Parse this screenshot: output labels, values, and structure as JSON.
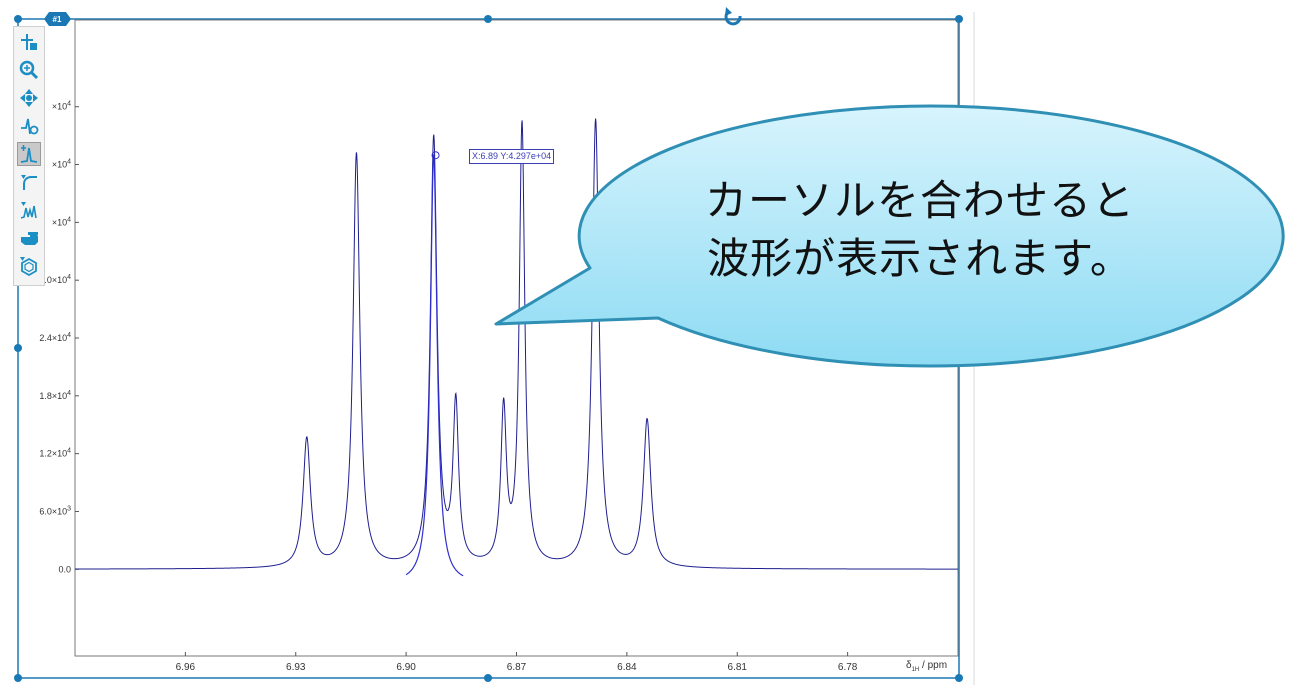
{
  "plot_badge": "#1",
  "toolbar": {
    "tools": [
      {
        "icon": "crosshair-cursor-icon",
        "active": false
      },
      {
        "icon": "zoom-icon",
        "active": false
      },
      {
        "icon": "pan-icon",
        "active": false
      },
      {
        "icon": "manual-peak-pick-icon",
        "active": false
      },
      {
        "icon": "peak-pick-icon",
        "active": true
      },
      {
        "icon": "integration-icon",
        "active": false
      },
      {
        "icon": "multiplet-analysis-icon",
        "active": false
      },
      {
        "icon": "pointer-hand-icon",
        "active": false
      },
      {
        "icon": "structure-icon",
        "active": false
      }
    ]
  },
  "cursor_readout": "X:6.89 Y:4.297e+04",
  "callout": {
    "line1": "カーソルを合わせると",
    "line2": "波形が表示されます。"
  },
  "axis_unit": "δ₁H / ppm",
  "colors": {
    "spectrum": "#1f1f8f",
    "frame": "#1a78b4",
    "bubble_fill_top": "#d7f4fd",
    "bubble_fill_bottom": "#8edbf3",
    "bubble_stroke": "#2f8fb4"
  },
  "chart_data": {
    "type": "line",
    "title": "",
    "xlabel": "δ1H / ppm",
    "ylabel": "",
    "x_reversed": true,
    "xlim": [
      6.99,
      6.75
    ],
    "ylim": [
      -9000,
      57000
    ],
    "x_ticks": [
      6.96,
      6.93,
      6.9,
      6.87,
      6.84,
      6.81,
      6.78
    ],
    "x_tick_labels": [
      "6.96",
      "6.93",
      "6.90",
      "6.87",
      "6.84",
      "6.81",
      "6.78"
    ],
    "y_ticks": [
      0,
      6000,
      12000,
      18000,
      24000,
      30000,
      36000,
      42000,
      48000
    ],
    "y_tick_labels": [
      {
        "m": "0.0",
        "e": ""
      },
      {
        "m": "6.0×10",
        "e": "3"
      },
      {
        "m": "1.2×10",
        "e": "4"
      },
      {
        "m": "1.8×10",
        "e": "4"
      },
      {
        "m": "2.4×10",
        "e": "4"
      },
      {
        "m": "3.0×10",
        "e": "4"
      },
      {
        "m": "×10",
        "e": "4"
      },
      {
        "m": "×10",
        "e": "4"
      },
      {
        "m": "×10",
        "e": "4"
      }
    ],
    "series": [
      {
        "peaks": [
          {
            "x": 6.927,
            "height": 13400,
            "width": 0.0012
          },
          {
            "x": 6.9135,
            "height": 43000,
            "width": 0.0011
          },
          {
            "x": 6.8925,
            "height": 44500,
            "width": 0.0011
          },
          {
            "x": 6.8865,
            "height": 16500,
            "width": 0.0009
          },
          {
            "x": 6.8735,
            "height": 16000,
            "width": 0.0009
          },
          {
            "x": 6.8685,
            "height": 45800,
            "width": 0.0009
          },
          {
            "x": 6.8485,
            "height": 46500,
            "width": 0.0011
          },
          {
            "x": 6.8345,
            "height": 15300,
            "width": 0.0012
          }
        ]
      }
    ],
    "highlight": {
      "x": 6.892,
      "y": 42970,
      "x_range": [
        6.9,
        6.8845
      ],
      "peaks": [
        {
          "x": 6.8925,
          "height": 44500,
          "width": 0.0011
        }
      ]
    }
  }
}
